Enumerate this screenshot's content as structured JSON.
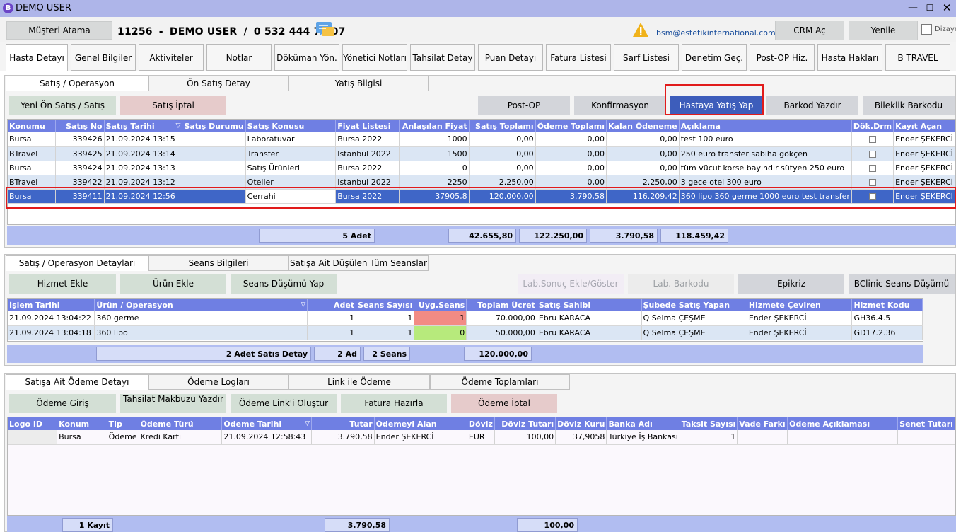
{
  "window": {
    "title": "DEMO USER",
    "logo_letter": "B"
  },
  "header": {
    "assign_button": "Müşteri Atama",
    "patient_id": "11256",
    "sep1": "-",
    "patient_name": "DEMO USER",
    "sep2": "/",
    "phone": "0 532 444 77 07",
    "email": "bsm@estetikinternational.com",
    "crm_button": "CRM Aç",
    "refresh_button": "Yenile",
    "design_label": "Dizayn"
  },
  "main_tabs": [
    "Hasta Detayı",
    "Genel Bilgiler",
    "Aktiviteler",
    "Notlar",
    "Döküman Yön.",
    "Yönetici Notları",
    "Tahsilat Detay",
    "Puan Detayı",
    "Fatura Listesi",
    "Sarf Listesi",
    "Denetim Geç.",
    "Post-OP Hiz.",
    "Hasta Hakları",
    "B TRAVEL"
  ],
  "sales": {
    "tabs": [
      "Satış / Operasyon",
      "Ön Satış Detay",
      "Yatış Bilgisi"
    ],
    "buttons": {
      "new_sale": "Yeni Ön Satış / Satış",
      "cancel_sale": "Satış İptal",
      "post_op": "Post-OP",
      "confirm": "Konfirmasyon",
      "admit": "Hastaya Yatış Yap",
      "barcode": "Barkod Yazdır",
      "wristband": "Bileklik Barkodu"
    },
    "columns": [
      "Konumu",
      "Satış No",
      "Satış Tarihi",
      "Satış Durumu",
      "Satış Konusu",
      "Fiyat Listesi",
      "Anlaşılan Fiyat",
      "Satış Toplamı",
      "Ödeme Toplamı",
      "Kalan Ödeneme",
      "Açıklama",
      "Dök.Drm",
      "Kayıt Açan"
    ],
    "rows": [
      [
        "Bursa",
        "339426",
        "21.09.2024 13:15",
        "",
        "Laboratuvar",
        "Bursa 2022",
        "1000",
        "0,00",
        "0,00",
        "0,00",
        "test 100 euro",
        "",
        "Ender ŞEKERCİ"
      ],
      [
        "BTravel",
        "339425",
        "21.09.2024 13:14",
        "",
        "Transfer",
        "Istanbul 2022",
        "1500",
        "0,00",
        "0,00",
        "0,00",
        "250 euro transfer sabiha gökçen",
        "",
        "Ender ŞEKERCİ"
      ],
      [
        "Bursa",
        "339424",
        "21.09.2024 13:13",
        "",
        "Satış Ürünleri",
        "Bursa 2022",
        "0",
        "0,00",
        "0,00",
        "0,00",
        "tüm vücut korse bayındır sütyen 250 euro",
        "",
        "Ender ŞEKERCİ"
      ],
      [
        "BTravel",
        "339422",
        "21.09.2024 13:12",
        "",
        "Oteller",
        "Istanbul 2022",
        "2250",
        "2.250,00",
        "0,00",
        "2.250,00",
        "3 gece otel 300 euro",
        "",
        "Ender ŞEKERCİ"
      ],
      [
        "Bursa",
        "339411",
        "21.09.2024 12:56",
        "",
        "Cerrahi",
        "Bursa 2022",
        "37905,8",
        "120.000,00",
        "3.790,58",
        "116.209,42",
        "360 lipo 360 germe 1000 euro test transfer",
        "",
        "Ender ŞEKERCİ"
      ]
    ],
    "footer": {
      "count": "5 Adet",
      "agreed": "42.655,80",
      "sales_total": "122.250,00",
      "paid": "3.790,58",
      "remaining": "118.459,42"
    }
  },
  "details": {
    "tabs": [
      "Satış / Operasyon Detayları",
      "Seans Bilgileri",
      "Satışa Ait Düşülen Tüm Seanslar"
    ],
    "buttons": {
      "add_service": "Hizmet Ekle",
      "add_product": "Ürün Ekle",
      "session_deduct": "Seans Düşümü Yap",
      "lab_result": "Lab.Sonuç Ekle/Göster",
      "lab_barcode": "Lab. Barkodu",
      "epikriz": "Epikriz",
      "bclinic": "BClinic Seans Düşümü"
    },
    "columns": [
      "İşlem Tarihi",
      "Ürün / Operasyon",
      "Adet",
      "Seans Sayısı",
      "Uyg.Seans",
      "Toplam Ücret",
      "Satış Sahibi",
      "Şubede Satış Yapan",
      "Hizmete Çeviren",
      "Hizmet Kodu"
    ],
    "rows": [
      [
        "21.09.2024 13:04:22",
        "360 germe",
        "1",
        "1",
        "1",
        "70.000,00",
        "Ebru KARACA",
        "Q Selma ÇEŞME",
        "Ender ŞEKERCİ",
        "GH36.4.5"
      ],
      [
        "21.09.2024 13:04:18",
        "360 lipo",
        "1",
        "1",
        "0",
        "50.000,00",
        "Ebru KARACA",
        "Q Selma ÇEŞME",
        "Ender ŞEKERCİ",
        "GD17.2.36"
      ]
    ],
    "footer": {
      "count": "2 Adet Satıs Detay",
      "qty": "2 Ad",
      "sessions": "2 Seans",
      "total": "120.000,00"
    }
  },
  "payments": {
    "tabs": [
      "Satışa Ait Ödeme Detayı",
      "Ödeme Logları",
      "Link ile Ödeme",
      "Ödeme Toplamları"
    ],
    "buttons": {
      "entry": "Ödeme Giriş",
      "receipt": "Tahsilat Makbuzu Yazdır",
      "link": "Ödeme Link'i Oluştur",
      "invoice": "Fatura Hazırla",
      "cancel": "Ödeme İptal"
    },
    "columns": [
      "Logo ID",
      "Konum",
      "Tip",
      "Ödeme Türü",
      "Ödeme Tarihi",
      "Tutar",
      "Ödemeyi Alan",
      "Döviz",
      "Döviz Tutarı",
      "Döviz Kuru",
      "Banka Adı",
      "Taksit Sayısı",
      "Vade Farkı",
      "Ödeme Açıklaması",
      "Senet Tutarı"
    ],
    "rows": [
      [
        "",
        "Bursa",
        "Ödeme",
        "Kredi Kartı",
        "21.09.2024 12:58:43",
        "3.790,58",
        "Ender ŞEKERCİ",
        "EUR",
        "100,00",
        "37,9058",
        "Türkiye İş Bankası",
        "1",
        "",
        "",
        ""
      ]
    ],
    "footer": {
      "count": "1 Kayıt",
      "amount": "3.790,58",
      "fx_amount": "100,00"
    }
  }
}
